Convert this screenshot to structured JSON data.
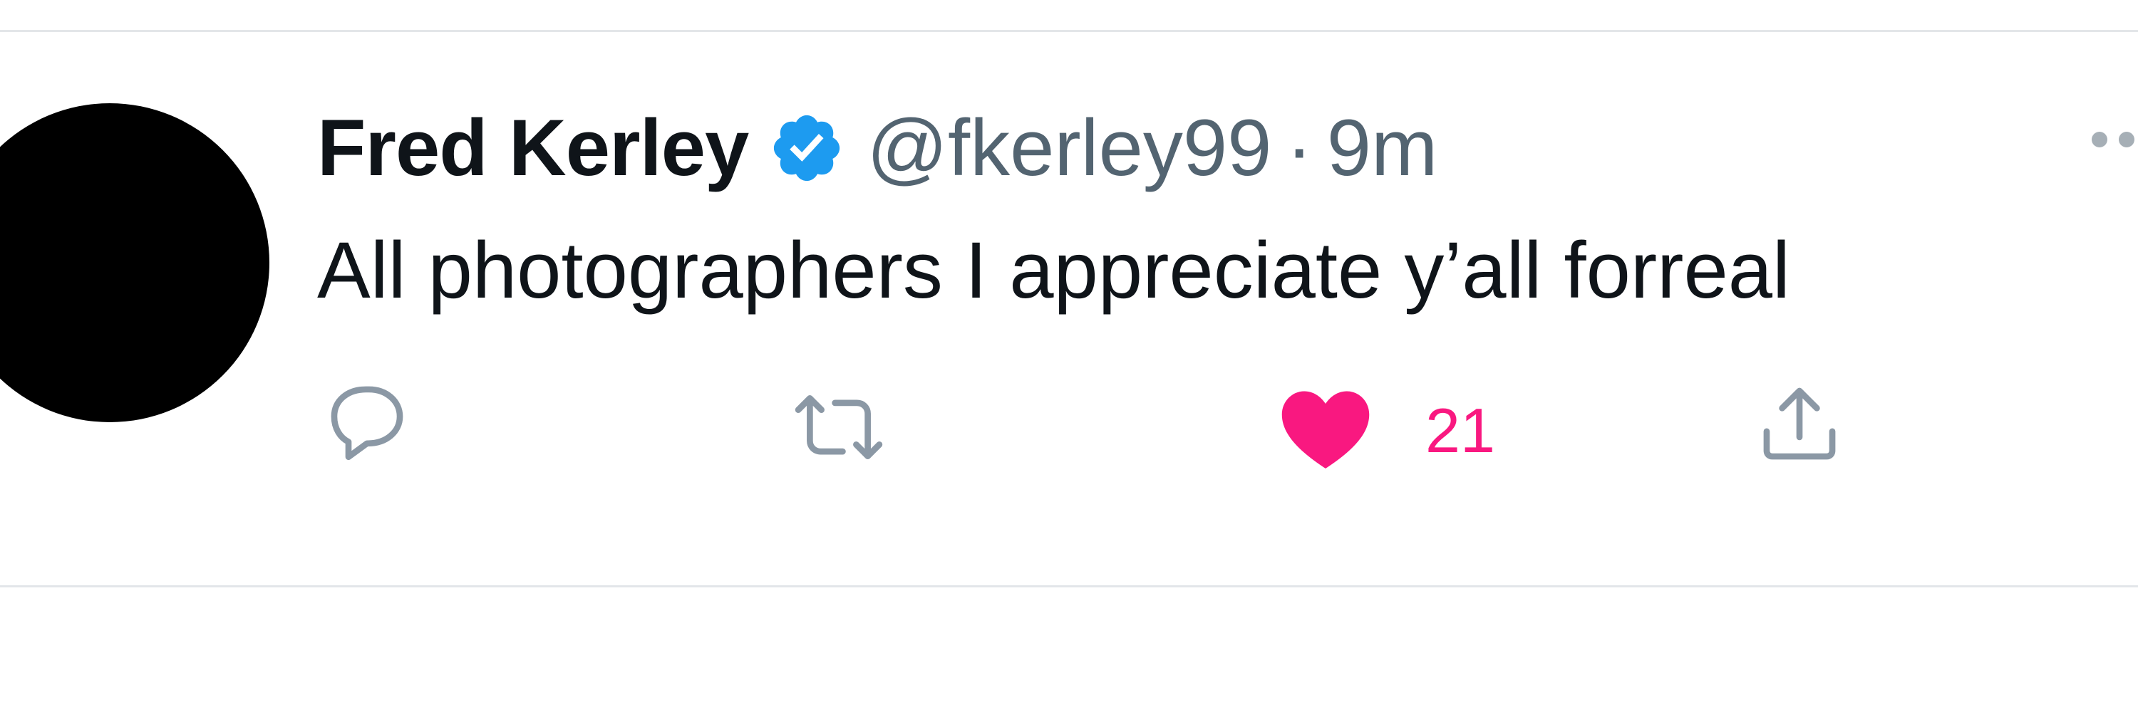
{
  "tweet": {
    "author_name": "Fred Kerley",
    "handle": "@fkerley99",
    "separator": "·",
    "time": "9m",
    "text": "All photographers I appreciate y’all forreal",
    "verified": true
  },
  "actions": {
    "reply_icon": "reply-bubble-icon",
    "retweet_icon": "retweet-icon",
    "like_icon": "heart-filled-icon",
    "like_count": "21",
    "share_icon": "share-upload-icon"
  },
  "colors": {
    "text": "#0f1419",
    "secondary": "#536471",
    "verified": "#1d9bf0",
    "like": "#f91880",
    "icon": "#8b98a5",
    "divider": "#e3e6e9"
  }
}
